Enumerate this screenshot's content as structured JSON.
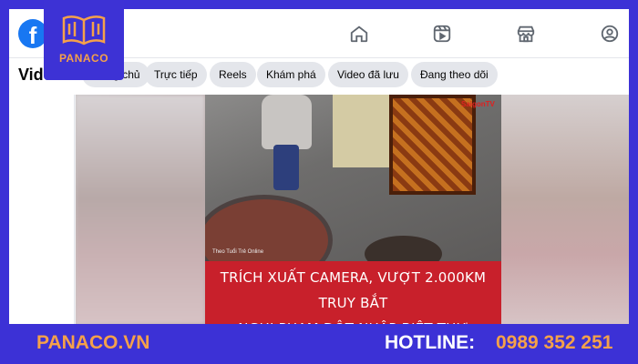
{
  "header": {
    "logo_letter": "f",
    "nav_icons": [
      "home-icon",
      "reels-icon",
      "marketplace-icon",
      "profile-icon"
    ]
  },
  "subnav": {
    "title": "Video",
    "pills": [
      "Trang chủ",
      "Trực tiếp",
      "Reels",
      "Khám phá",
      "Video đã lưu",
      "Đang theo dõi"
    ]
  },
  "video": {
    "channel_brand": "SaigonTV",
    "watermark": "Theo Tuổi Trẻ Online",
    "caption_line1": "TRÍCH XUẤT CAMERA, VƯỢT 2.000KM TRUY BẮT",
    "caption_line2": "NGHI PHẠM ĐỘT NHẬP BIỆT THỰ"
  },
  "badge": {
    "brand": "PANACO"
  },
  "footer": {
    "site": "PANACO.VN",
    "hotline_label": "HOTLINE:",
    "hotline_number": "0989 352 251"
  },
  "colors": {
    "frame": "#3c31d6",
    "accent": "#f5a14a",
    "facebook_blue": "#1877f2",
    "caption_red": "#c8202b"
  }
}
